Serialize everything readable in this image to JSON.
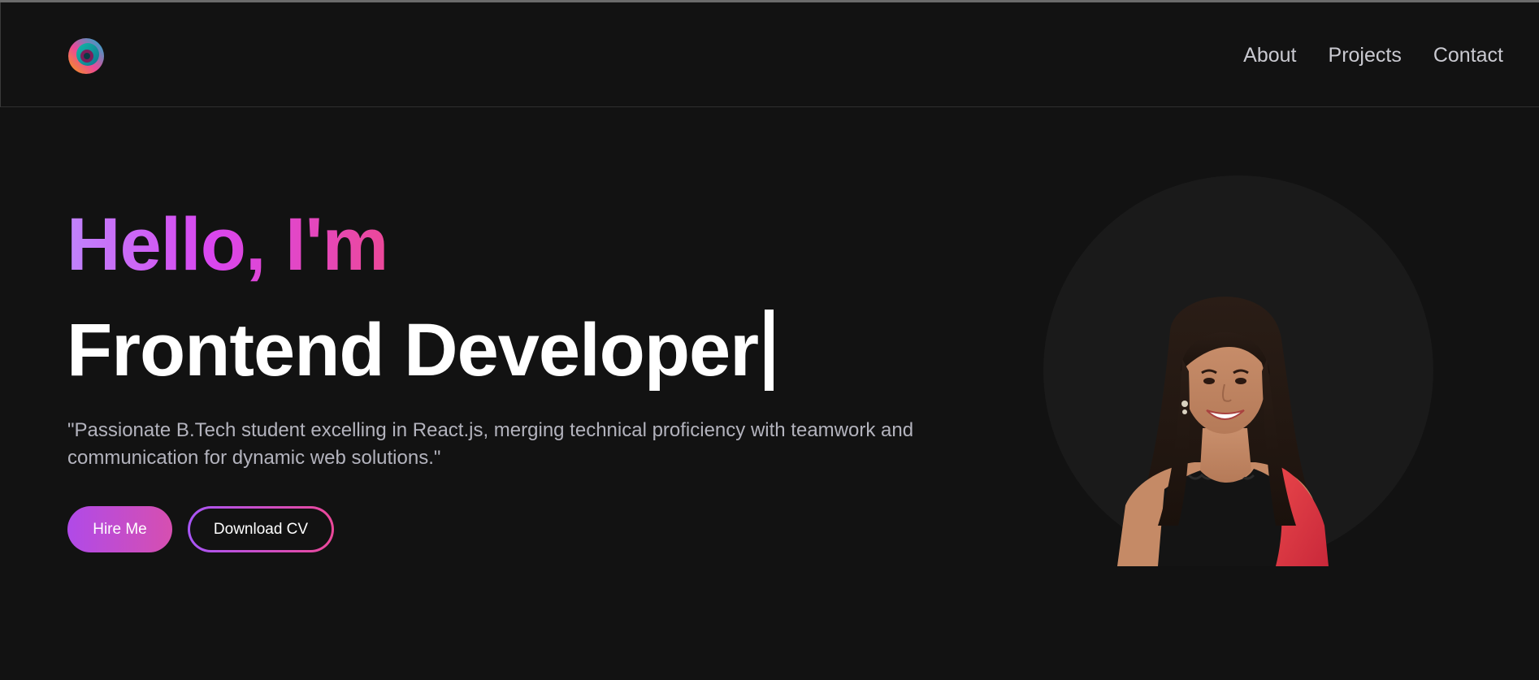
{
  "nav": {
    "logo_icon": "colorful-ring-logo-icon",
    "links": [
      "About",
      "Projects",
      "Contact"
    ]
  },
  "hero": {
    "greeting": "Hello, I'm",
    "role": "Frontend Developer",
    "tagline": "\"Passionate B.Tech student excelling in React.js, merging technical proficiency with teamwork and communication for dynamic web solutions.\"",
    "primary_button": "Hire Me",
    "secondary_button": "Download CV",
    "portrait_icon": "profile-photo"
  },
  "colors": {
    "background": "#121212",
    "accent_start": "#c084fc",
    "accent_end": "#ec4899"
  }
}
